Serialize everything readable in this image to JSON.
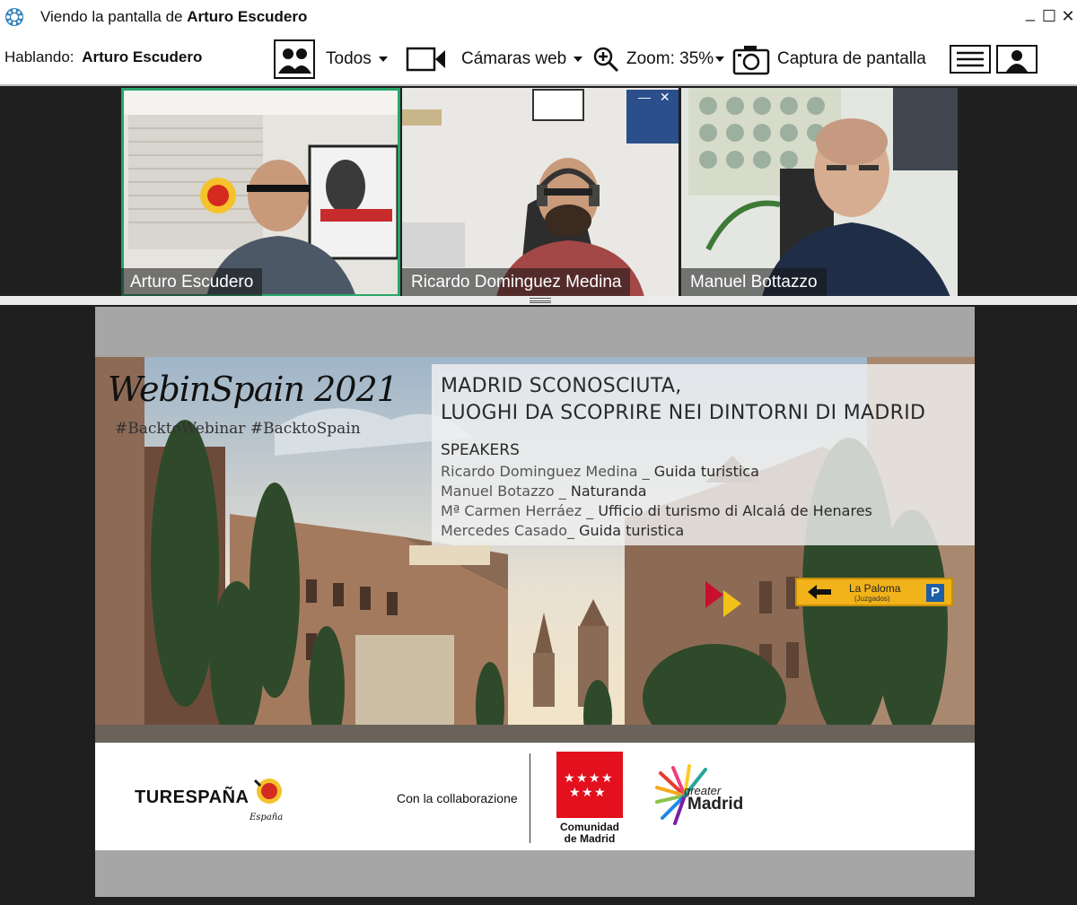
{
  "window": {
    "title_prefix": "Viendo la pantalla de",
    "title_name": "Arturo Escudero",
    "minimize": "_",
    "maximize": "☐",
    "close": "✕"
  },
  "toolbar": {
    "speaking_label": "Hablando:",
    "speaking_name": "Arturo Escudero",
    "view_label": "Todos",
    "cameras_label": "Cámaras web",
    "zoom_label": "Zoom: 35%",
    "capture_label": "Captura de pantalla"
  },
  "participants": [
    {
      "name": "Arturo Escudero",
      "active": true
    },
    {
      "name": "Ricardo Dominguez Medina",
      "active": false
    },
    {
      "name": "Manuel Bottazzo",
      "active": false
    }
  ],
  "slide": {
    "event_title": "WebinSpain 2021",
    "hashtags": "#BacktoWebinar #BacktoSpain",
    "headline_line1": "MADRID SCONOSCIUTA,",
    "headline_line2": "LUOGHI DA SCOPRIRE NEI DINTORNI DI MADRID",
    "speakers_title": "SPEAKERS",
    "speakers": [
      {
        "name": "Ricardo Dominguez Medina _",
        "role": "Guida turistica"
      },
      {
        "name": "Manuel Botazzo  _",
        "role": "Naturanda"
      },
      {
        "name": "Mª Carmen Herráez _",
        "role": "Ufficio di turismo di Alcalá de Henares"
      },
      {
        "name": "Mercedes Casado_",
        "role": "Guida turistica"
      }
    ],
    "sign_label": "La Paloma",
    "sign_sub": "(Juzgados)",
    "sign_p": "P",
    "footer_turespana": "TURESPAÑA",
    "footer_espana": "España",
    "footer_collab": "Con la collaborazione",
    "footer_comunidad_1": "Comunidad",
    "footer_comunidad_2": "de Madrid",
    "footer_greater": "greater",
    "footer_madrid": "Madrid"
  },
  "colors": {
    "active_tile_border": "#27a76a",
    "comunidad_red": "#e3101e"
  }
}
